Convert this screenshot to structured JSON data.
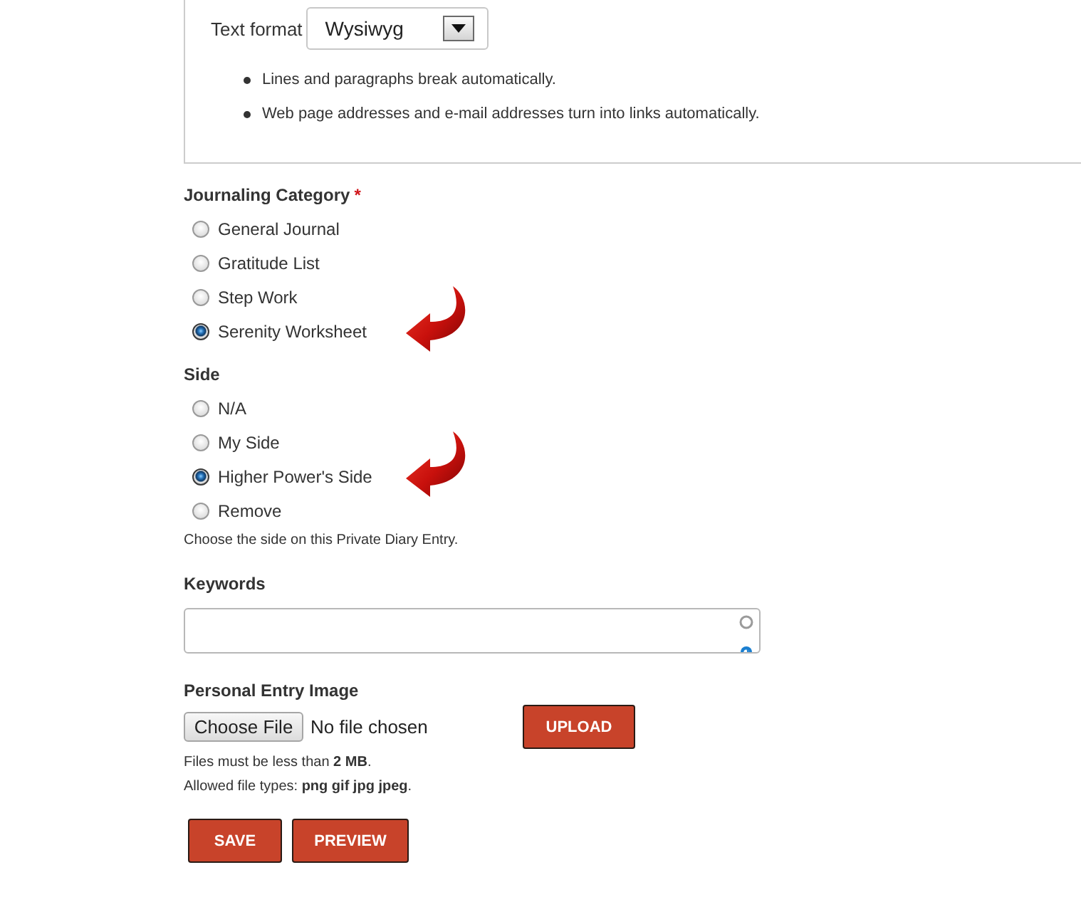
{
  "text_format": {
    "label": "Text format",
    "value": "Wysiwyg",
    "tips": [
      "Lines and paragraphs break automatically.",
      "Web page addresses and e-mail addresses turn into links automatically."
    ]
  },
  "journaling_category": {
    "label": "Journaling Category",
    "required": true,
    "required_mark": "*",
    "options": [
      {
        "label": "General Journal",
        "selected": false,
        "marked": false
      },
      {
        "label": "Gratitude List",
        "selected": false,
        "marked": false
      },
      {
        "label": "Step Work",
        "selected": false,
        "marked": false
      },
      {
        "label": "Serenity Worksheet",
        "selected": true,
        "marked": true
      }
    ]
  },
  "side": {
    "label": "Side",
    "options": [
      {
        "label": "N/A",
        "selected": false,
        "marked": false
      },
      {
        "label": "My Side",
        "selected": false,
        "marked": false
      },
      {
        "label": "Higher Power's Side",
        "selected": true,
        "marked": true
      },
      {
        "label": "Remove",
        "selected": false,
        "marked": false
      }
    ],
    "description": "Choose the side on this Private Diary Entry."
  },
  "keywords": {
    "label": "Keywords"
  },
  "personal_entry_image": {
    "label": "Personal Entry Image",
    "choose_button": "Choose File",
    "file_status": "No file chosen",
    "upload_button": "UPLOAD",
    "help": [
      "Files must be less than **2 MB**.",
      "Allowed file types: **png gif jpg jpeg**."
    ]
  },
  "buttons": [
    "SAVE",
    "PREVIEW"
  ]
}
